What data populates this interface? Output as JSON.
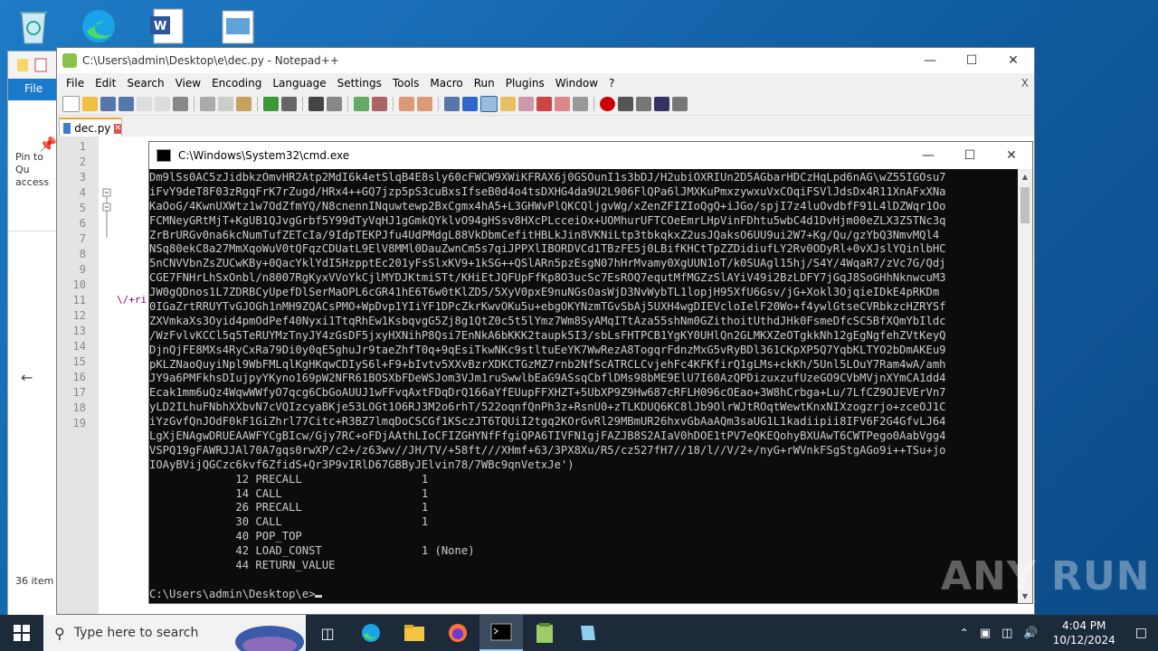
{
  "desktop": {
    "icons": [
      "recycle-bin-icon",
      "edge-icon",
      "word-icon",
      "image-file-icon"
    ]
  },
  "explorer": {
    "file_tab": "File",
    "pin_label": "Pin to Qu access",
    "items_count": "36 item"
  },
  "notepad": {
    "title": "C:\\Users\\admin\\Desktop\\e\\dec.py - Notepad++",
    "menu": [
      "File",
      "Edit",
      "Search",
      "View",
      "Encoding",
      "Language",
      "Settings",
      "Tools",
      "Macro",
      "Run",
      "Plugins",
      "Window",
      "?"
    ],
    "menu_close": "X",
    "tab_label": "dec.py",
    "line_numbers": [
      "1",
      "2",
      "3",
      "4",
      "5",
      "6",
      "7",
      "8",
      "9",
      "10",
      "11",
      "12",
      "13",
      "14",
      "15",
      "16",
      "17",
      "18",
      "19"
    ],
    "code_fragment": "\\/+ri"
  },
  "cmd": {
    "title": "C:\\Windows\\System32\\cmd.exe",
    "lines": [
      "Dm9lSs0AC5zJidbkzOmvHR2Atp2MdI6k4etSlqB4E8sly60cFWCW9XWiKFRAX6j0GSOunI1s3bDJ/H2ubiOXRIUn2D5AGbarHDCzHqLpd6nAG\\wZ55IGOsu7",
      "iFvY9deT8F03zRgqFrK7rZugd/HRx4++GQ7jzp5pS3cuBxsIfseB0d4o4tsDXHG4da9U2L906FlQPa6lJMXKuPmxzywxuVxCOqiFSVlJdsDx4R11XnAFxXNa",
      "KaOoG/4KwnUXWtz1w7OdZfmYQ/N8cnennINquwtewp2BxCgmx4hA5+L3GHWvPlQKCQljgvWg/xZenZFIZIoQgQ+iJGo/spjI7z4luOvdbfF91L4lDZWqr1Oo",
      "FCMNeyGRtMjT+KgUB1QJvgGrbf5Y99dTyVqHJ1gGmkQYklvO94gHSsv8HXcPLcceiOx+UOMhurUFTCOeEmrLHpVinFDhtu5wbC4d1DvHjm00eZLX3Z5TNc3q",
      "ZrBrURGv0na6kcNumTufZETcIa/9IdpTEKPJfu4UdPMdgL88VkDbmCefitHBLkJin8VKNiLtp3tbkqkxZ2usJQaksO6UU9ui2W7+Kg/Qu/gzYbQ3NmvMQl4",
      "NSq80ekC8a27MmXqoWuV0tQFqzCDUatL9ElV8MMl0DauZwnCm5s7qiJPPXlIBORDVCd1TBzFE5j0LBifKHCtTpZZDidiufLY2Rv0ODyRl+0vXJslYQinlbHC",
      "5nCNVVbnZsZUCwKBy+0QacYklYdI5HzpptEc201yFsSlxKV9+1kSG++QSlARn5pzEsgN07hHrMvamy0XgUUN1oT/k0SUAgl15hj/S4Y/4WqaR7/zVc7G/Qdj",
      "CGE7FNHrLhSxOnbl/n8007RgKyxVVoYkCjlMYDJKtmiSTt/KHiEtJQFUpFfKp8O3ucSc7EsROQ7equtMfMGZzSlAYiV49i2BzLDFY7jGqJ8SoGHhNknwcuM3",
      "JW0gQDnos1L7ZDRBCyUpefDlSerMaOPL6cGR41hE6T6w0tKlZD5/5XyV0pxE9nuNGsOasWjD3NvWybTL1lopjH95XfU6Gsv/jG+Xokl3OjqieIDkE4pRKDm",
      "0IGaZrtRRUYTvGJOGh1nMH9ZQACsPMO+WpDvp1YIiYF1DPcZkrKwvOKu5u+ebgOKYNzmTGvSbAj5UXH4wgDIEVcloIelF20Wo+f4ywlGtseCVRbkzcHZRYSf",
      "ZXVmkaXs3Oyid4pmOdPef40Nyxi1TtqRhEw1KsbqvgG5Zj8g1QtZ0c5t5lYmz7Wm8SyAMqITtAza55shNm0GZithoitUthdJHk0FsmeDfcSC5BfXQmYbIldc",
      "/WzFvlvKCCl5q5TeRUYMzTnyJY4zGsDF5jxyHXNihP8Qsi7EnNkA6bKKK2taupk5I3/sbLsFHTPCB1YgKY0UHlQn2GLMKXZeOTgkkNh12gEgNgfehZVtKeyQ",
      "DjnQjFE8MXs4RyCxRa79Di0y0qE5ghuJr9taeZhfT0q+9qEsiTkwNKc9stltuEeYK7WwRezA8TogqrFdnzMxG5vRyBDl361CKpXP5Q7YqbKLTYO2bDmAKEu9",
      "pKLZNaoQuyiNpl9WbFMLqlKgHKqwCDIyS6l+F9+bIvtv5XXvBzrXDKCTGzMZ7rnb2NfScATRCLCvjehFc4KFKfirQ1gLMs+ckKh/5Unl5LOuY7Ram4wA/amh",
      "JY9a6PMFkhsDIujpyYKyno169pW2NFR61BOSXbFDeWSJom3VJm1ruSwwlbEaG9ASsqCbflDMs98bME9ElU7I60AzQPDizuxzufUzeGO9CVbMVjnXYmCA1dd4",
      "Ecak1mm6uQz4WqwWWfyO7qcg6CbGoAUUJ1wFFvqAxtFDqDrQ166aYfEUupFFXHZT+5UbXP9Z9Hw687cRFLH096cOEao+3W8hCrbga+Lu/7LfCZ9OJEVErVn7",
      "yLD2ILhuFNbhXXbvN7cVQIzcyaBKje53LOGt1O6RJ3M2o6rhT/522oqnfQnPh3z+RsnU0+zTLKDUQ6KC8lJb9OlrWJtROqtWewtKnxNIXzogzrjo+zceOJ1C",
      "iYzGvfQnJOdF0kF1GiZhrl77Citc+R3BZ7lmqDoCSCGf1KSczJT6TQUiI2tgq2KOrGvRl29MBmUR26hxvGbAaAQm3saUG1L1kadiipii8IFV6F2G4GfvLJ64",
      "LgXjENAgwDRUEAAWFYCgBIcw/Gjy7RC+oFDjAAthLIoCFIZGHYNfFfgiQPA6TIVFN1gjFAZJB8S2AIaV0hDOE1tPV7eQKEQohyBXUAwT6CWTPego0AabVgg4",
      "VSPQ19gFAWRJJAl70A7gqs0rwXP/c2+/z63wv//JH/TV/+58ft///XHmf+63/3PX8Xu/R5/cz527fH7//18/l//V/2+/nyG+rWVnkFSgStgAGo9i++TSu+jo",
      "IOAyBVijQGCzc6kvf6ZfidS+Qr3P9vIRlD67GBByJElvin78/7WBc9qnVetxJe')",
      "             12 PRECALL                  1",
      "             14 CALL                     1",
      "             26 PRECALL                  1",
      "             30 CALL                     1",
      "             40 POP_TOP",
      "             42 LOAD_CONST               1 (None)",
      "             44 RETURN_VALUE",
      "",
      "C:\\Users\\admin\\Desktop\\e>"
    ]
  },
  "watermark": "ANY RUN",
  "taskbar": {
    "search_placeholder": "Type here to search",
    "time": "4:04 PM",
    "date": "10/12/2024"
  }
}
